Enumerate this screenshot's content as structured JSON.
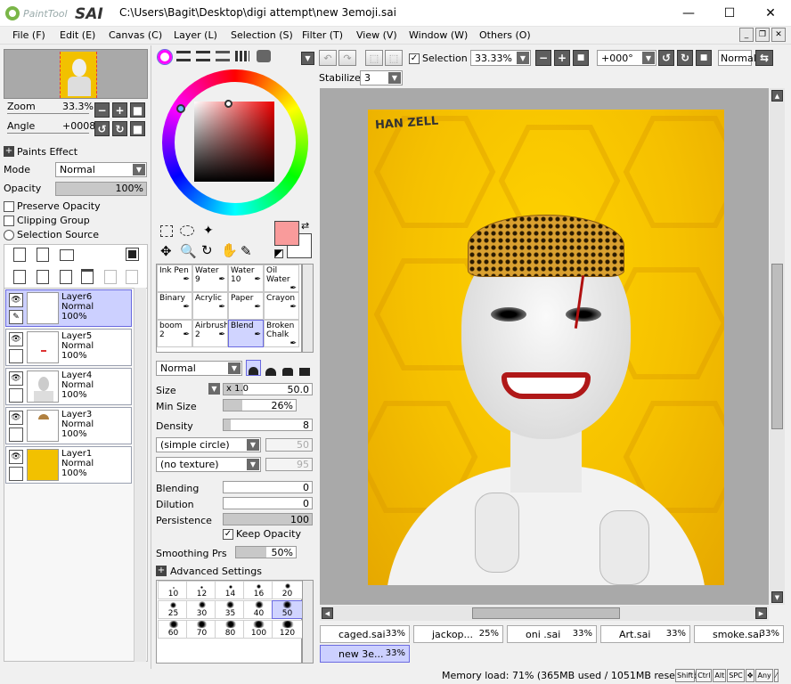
{
  "app": {
    "logo_text": "PaintTool SAI",
    "path": "C:\\Users\\Bagit\\Desktop\\digi attempt\\new 3emoji.sai"
  },
  "window_controls": {
    "minimize": "—",
    "maximize": "☐",
    "close": "✕"
  },
  "menu": [
    "File (F)",
    "Edit (E)",
    "Canvas (C)",
    "Layer (L)",
    "Selection (S)",
    "Filter (T)",
    "View (V)",
    "Window (W)",
    "Others (O)"
  ],
  "navigator": {
    "zoom_label": "Zoom",
    "zoom_value": "33.3%",
    "angle_label": "Angle",
    "angle_value": "+0008"
  },
  "paint_effects": "Paints Effect",
  "mode": {
    "label": "Mode",
    "value": "Normal"
  },
  "opacity": {
    "label": "Opacity",
    "value": "100%"
  },
  "checks": {
    "preserve": "Preserve Opacity",
    "clipping": "Clipping Group",
    "selection_source": "Selection Source"
  },
  "layers": [
    {
      "name": "Layer6",
      "mode": "Normal",
      "opacity": "100%"
    },
    {
      "name": "Layer5",
      "mode": "Normal",
      "opacity": "100%"
    },
    {
      "name": "Layer4",
      "mode": "Normal",
      "opacity": "100%"
    },
    {
      "name": "Layer3",
      "mode": "Normal",
      "opacity": "100%"
    },
    {
      "name": "Layer1",
      "mode": "Normal",
      "opacity": "100%"
    }
  ],
  "brushes": [
    {
      "name": "Ink Pen",
      "num": ""
    },
    {
      "name": "Water",
      "num": "9"
    },
    {
      "name": "Water",
      "num": "10"
    },
    {
      "name": "Oil Water",
      "num": ""
    },
    {
      "name": "Binary",
      "num": ""
    },
    {
      "name": "Acrylic",
      "num": ""
    },
    {
      "name": "Paper",
      "num": ""
    },
    {
      "name": "Crayon",
      "num": ""
    },
    {
      "name": "boom",
      "num": "2"
    },
    {
      "name": "Airbrush",
      "num": "2"
    },
    {
      "name": "Blend",
      "num": ""
    },
    {
      "name": "Broken Chalk",
      "num": ""
    }
  ],
  "brush_mode": "Normal",
  "size": {
    "label": "Size",
    "mult": "x 1.0",
    "value": "50.0"
  },
  "min_size": {
    "label": "Min Size",
    "value": "26%"
  },
  "density": {
    "label": "Density",
    "value": "8"
  },
  "shape": {
    "value": "(simple circle)",
    "num": "50"
  },
  "texture": {
    "value": "(no texture)",
    "num": "95"
  },
  "blending": {
    "label": "Blending",
    "value": "0"
  },
  "dilution": {
    "label": "Dilution",
    "value": "0"
  },
  "persistence": {
    "label": "Persistence",
    "value": "100"
  },
  "keep_opacity": "Keep Opacity",
  "smoothing": {
    "label": "Smoothing Prs",
    "value": "50%"
  },
  "advanced": "Advanced Settings",
  "brush_sizes": [
    "10",
    "12",
    "14",
    "16",
    "20",
    "25",
    "30",
    "35",
    "40",
    "50",
    "60",
    "70",
    "80",
    "100",
    "120"
  ],
  "toolbar": {
    "selection": "Selection",
    "zoom": "33.33%",
    "rotation": "+000°",
    "mode": "Normal"
  },
  "stabilizer": {
    "label": "Stabilizer",
    "value": "3"
  },
  "signature": "HAN ZELL",
  "tabs": [
    {
      "name": "caged.sai",
      "pct": "33%"
    },
    {
      "name": "jackop...",
      "pct": "25%"
    },
    {
      "name": "oni .sai",
      "pct": "33%"
    },
    {
      "name": "Art.sai",
      "pct": "33%"
    },
    {
      "name": "smoke.sai",
      "pct": "33%"
    },
    {
      "name": "new 3e...",
      "pct": "33%"
    }
  ],
  "status": "Memory load: 71% (365MB used / 1051MB reserved)",
  "status_keys": [
    "Shift",
    "Ctrl",
    "Alt",
    "SPC",
    "✥",
    "Any",
    "⁄"
  ],
  "colors": {
    "primary": "#f99b9b",
    "background_canvas": "#f7c400",
    "selected_layer": "#ccd0ff"
  }
}
